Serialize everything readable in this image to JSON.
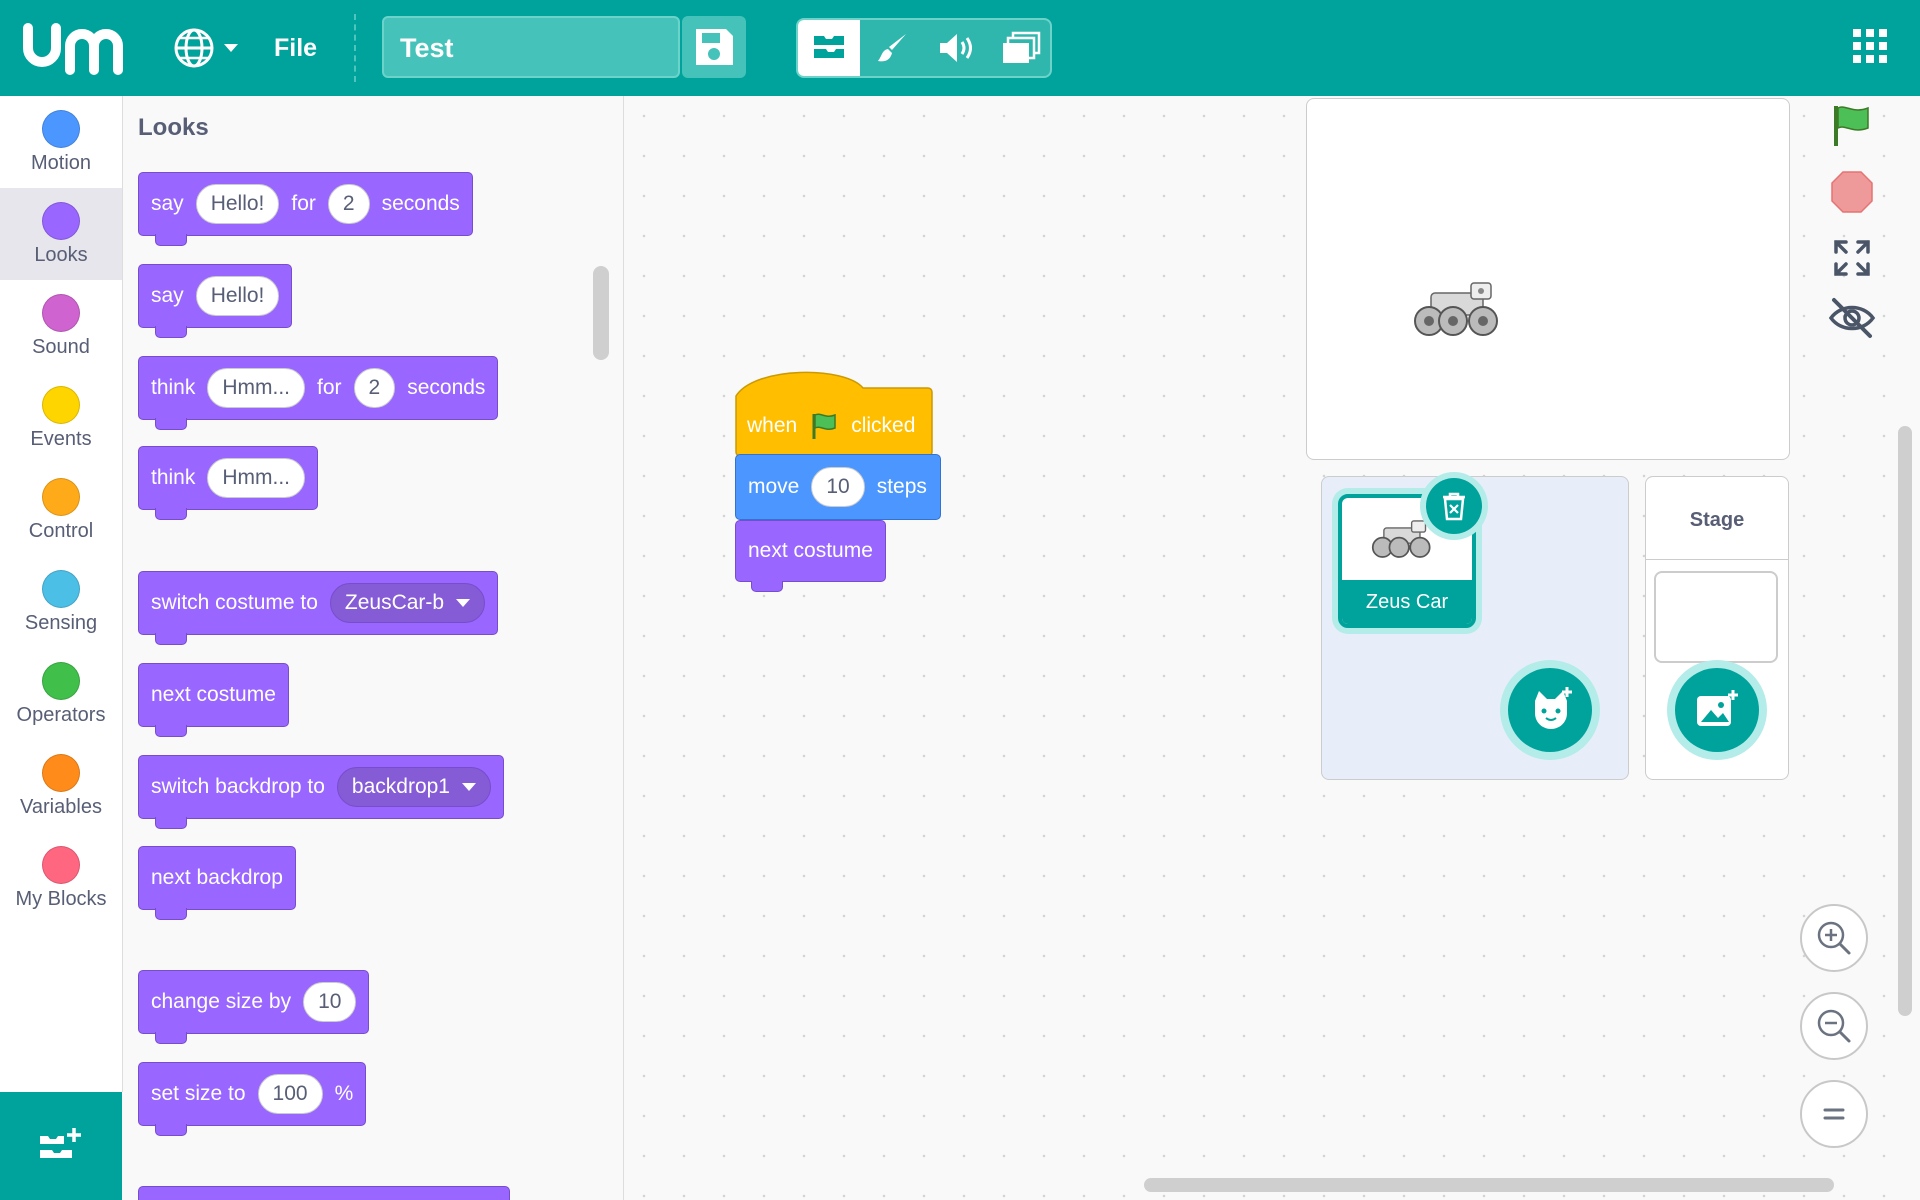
{
  "header": {
    "file_label": "File",
    "project_title": "Test",
    "modes": [
      "code-icon",
      "paint-brush-icon",
      "sound-icon",
      "layers-icon"
    ]
  },
  "categories": [
    {
      "label": "Motion",
      "color": "#4c97ff"
    },
    {
      "label": "Looks",
      "color": "#9966ff"
    },
    {
      "label": "Sound",
      "color": "#cf63cf"
    },
    {
      "label": "Events",
      "color": "#ffd500"
    },
    {
      "label": "Control",
      "color": "#ffab19"
    },
    {
      "label": "Sensing",
      "color": "#4cbfe6"
    },
    {
      "label": "Operators",
      "color": "#40bf4a"
    },
    {
      "label": "Variables",
      "color": "#ff8c1a"
    },
    {
      "label": "My Blocks",
      "color": "#ff6680"
    }
  ],
  "palette": {
    "title": "Looks",
    "say_for": {
      "w1": "say",
      "v1": "Hello!",
      "w2": "for",
      "v2": "2",
      "w3": "seconds"
    },
    "say": {
      "w1": "say",
      "v1": "Hello!"
    },
    "think_for": {
      "w1": "think",
      "v1": "Hmm...",
      "w2": "for",
      "v2": "2",
      "w3": "seconds"
    },
    "think": {
      "w1": "think",
      "v1": "Hmm..."
    },
    "switch_costume": {
      "w1": "switch costume to",
      "v1": "ZeusCar-b"
    },
    "next_costume": {
      "w1": "next costume"
    },
    "switch_backdrop": {
      "w1": "switch backdrop to",
      "v1": "backdrop1"
    },
    "next_backdrop": {
      "w1": "next backdrop"
    },
    "change_size": {
      "w1": "change size by",
      "v1": "10"
    },
    "set_size": {
      "w1": "set size to",
      "v1": "100",
      "w2": "%"
    }
  },
  "script": {
    "hat": {
      "w1": "when",
      "w2": "clicked"
    },
    "move": {
      "w1": "move",
      "v1": "10",
      "w2": "steps"
    },
    "next": {
      "w1": "next costume"
    }
  },
  "sprites": {
    "items": [
      {
        "name": "Zeus Car"
      }
    ],
    "stage_label": "Stage"
  },
  "colors": {
    "accent": "#00a39b",
    "looks": "#9966ff",
    "motion": "#4c97ff",
    "events": "#ffbf00"
  }
}
